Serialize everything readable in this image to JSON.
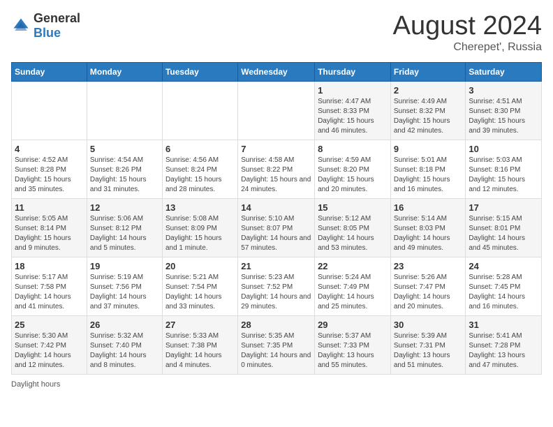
{
  "header": {
    "logo_general": "General",
    "logo_blue": "Blue",
    "month_year": "August 2024",
    "location": "Cherepet', Russia"
  },
  "columns": [
    "Sunday",
    "Monday",
    "Tuesday",
    "Wednesday",
    "Thursday",
    "Friday",
    "Saturday"
  ],
  "weeks": [
    [
      {
        "day": "",
        "info": ""
      },
      {
        "day": "",
        "info": ""
      },
      {
        "day": "",
        "info": ""
      },
      {
        "day": "",
        "info": ""
      },
      {
        "day": "1",
        "info": "Sunrise: 4:47 AM\nSunset: 8:33 PM\nDaylight: 15 hours and 46 minutes."
      },
      {
        "day": "2",
        "info": "Sunrise: 4:49 AM\nSunset: 8:32 PM\nDaylight: 15 hours and 42 minutes."
      },
      {
        "day": "3",
        "info": "Sunrise: 4:51 AM\nSunset: 8:30 PM\nDaylight: 15 hours and 39 minutes."
      }
    ],
    [
      {
        "day": "4",
        "info": "Sunrise: 4:52 AM\nSunset: 8:28 PM\nDaylight: 15 hours and 35 minutes."
      },
      {
        "day": "5",
        "info": "Sunrise: 4:54 AM\nSunset: 8:26 PM\nDaylight: 15 hours and 31 minutes."
      },
      {
        "day": "6",
        "info": "Sunrise: 4:56 AM\nSunset: 8:24 PM\nDaylight: 15 hours and 28 minutes."
      },
      {
        "day": "7",
        "info": "Sunrise: 4:58 AM\nSunset: 8:22 PM\nDaylight: 15 hours and 24 minutes."
      },
      {
        "day": "8",
        "info": "Sunrise: 4:59 AM\nSunset: 8:20 PM\nDaylight: 15 hours and 20 minutes."
      },
      {
        "day": "9",
        "info": "Sunrise: 5:01 AM\nSunset: 8:18 PM\nDaylight: 15 hours and 16 minutes."
      },
      {
        "day": "10",
        "info": "Sunrise: 5:03 AM\nSunset: 8:16 PM\nDaylight: 15 hours and 12 minutes."
      }
    ],
    [
      {
        "day": "11",
        "info": "Sunrise: 5:05 AM\nSunset: 8:14 PM\nDaylight: 15 hours and 9 minutes."
      },
      {
        "day": "12",
        "info": "Sunrise: 5:06 AM\nSunset: 8:12 PM\nDaylight: 14 hours and 5 minutes."
      },
      {
        "day": "13",
        "info": "Sunrise: 5:08 AM\nSunset: 8:09 PM\nDaylight: 15 hours and 1 minute."
      },
      {
        "day": "14",
        "info": "Sunrise: 5:10 AM\nSunset: 8:07 PM\nDaylight: 14 hours and 57 minutes."
      },
      {
        "day": "15",
        "info": "Sunrise: 5:12 AM\nSunset: 8:05 PM\nDaylight: 14 hours and 53 minutes."
      },
      {
        "day": "16",
        "info": "Sunrise: 5:14 AM\nSunset: 8:03 PM\nDaylight: 14 hours and 49 minutes."
      },
      {
        "day": "17",
        "info": "Sunrise: 5:15 AM\nSunset: 8:01 PM\nDaylight: 14 hours and 45 minutes."
      }
    ],
    [
      {
        "day": "18",
        "info": "Sunrise: 5:17 AM\nSunset: 7:58 PM\nDaylight: 14 hours and 41 minutes."
      },
      {
        "day": "19",
        "info": "Sunrise: 5:19 AM\nSunset: 7:56 PM\nDaylight: 14 hours and 37 minutes."
      },
      {
        "day": "20",
        "info": "Sunrise: 5:21 AM\nSunset: 7:54 PM\nDaylight: 14 hours and 33 minutes."
      },
      {
        "day": "21",
        "info": "Sunrise: 5:23 AM\nSunset: 7:52 PM\nDaylight: 14 hours and 29 minutes."
      },
      {
        "day": "22",
        "info": "Sunrise: 5:24 AM\nSunset: 7:49 PM\nDaylight: 14 hours and 25 minutes."
      },
      {
        "day": "23",
        "info": "Sunrise: 5:26 AM\nSunset: 7:47 PM\nDaylight: 14 hours and 20 minutes."
      },
      {
        "day": "24",
        "info": "Sunrise: 5:28 AM\nSunset: 7:45 PM\nDaylight: 14 hours and 16 minutes."
      }
    ],
    [
      {
        "day": "25",
        "info": "Sunrise: 5:30 AM\nSunset: 7:42 PM\nDaylight: 14 hours and 12 minutes."
      },
      {
        "day": "26",
        "info": "Sunrise: 5:32 AM\nSunset: 7:40 PM\nDaylight: 14 hours and 8 minutes."
      },
      {
        "day": "27",
        "info": "Sunrise: 5:33 AM\nSunset: 7:38 PM\nDaylight: 14 hours and 4 minutes."
      },
      {
        "day": "28",
        "info": "Sunrise: 5:35 AM\nSunset: 7:35 PM\nDaylight: 14 hours and 0 minutes."
      },
      {
        "day": "29",
        "info": "Sunrise: 5:37 AM\nSunset: 7:33 PM\nDaylight: 13 hours and 55 minutes."
      },
      {
        "day": "30",
        "info": "Sunrise: 5:39 AM\nSunset: 7:31 PM\nDaylight: 13 hours and 51 minutes."
      },
      {
        "day": "31",
        "info": "Sunrise: 5:41 AM\nSunset: 7:28 PM\nDaylight: 13 hours and 47 minutes."
      }
    ]
  ],
  "footer": {
    "daylight_label": "Daylight hours"
  }
}
